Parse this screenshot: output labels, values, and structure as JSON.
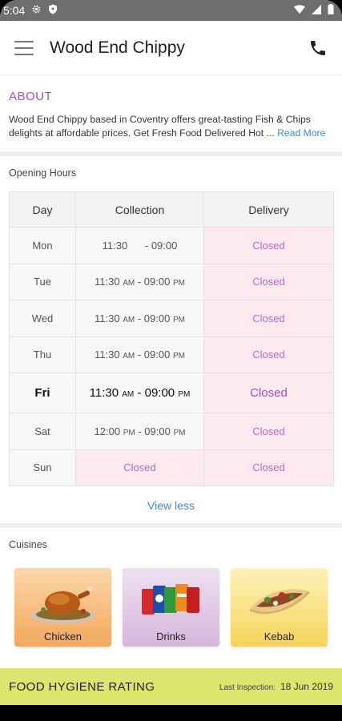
{
  "status": {
    "time": "5:04"
  },
  "appbar": {
    "title": "Wood End Chippy"
  },
  "about": {
    "heading": "ABOUT",
    "text": "Wood End Chippy based in Coventry offers great-tasting Fish & Chips delights at affordable prices. Get Fresh Food Delivered Hot",
    "ellipsis": " ... ",
    "read_more": "Read More"
  },
  "hours": {
    "heading": "Opening Hours",
    "columns": [
      "Day",
      "Collection",
      "Delivery"
    ],
    "rows": [
      {
        "day": "Mon",
        "open": "11:30",
        "open_ampm": "",
        "sep": " - ",
        "close": "09:00",
        "close_ampm": "",
        "delivery": "Closed"
      },
      {
        "day": "Tue",
        "open": "11:30",
        "open_ampm": "AM",
        "sep": " - ",
        "close": "09:00",
        "close_ampm": "PM",
        "delivery": "Closed"
      },
      {
        "day": "Wed",
        "open": "11:30",
        "open_ampm": "AM",
        "sep": " - ",
        "close": "09:00",
        "close_ampm": "PM",
        "delivery": "Closed"
      },
      {
        "day": "Thu",
        "open": "11:30",
        "open_ampm": "AM",
        "sep": " - ",
        "close": "09:00",
        "close_ampm": "PM",
        "delivery": "Closed"
      },
      {
        "day": "Fri",
        "open": "11:30",
        "open_ampm": "AM",
        "sep": " - ",
        "close": "09:00",
        "close_ampm": "PM",
        "delivery": "Closed"
      },
      {
        "day": "Sat",
        "open": "12:00",
        "open_ampm": "PM",
        "sep": " - ",
        "close": "09:00",
        "close_ampm": "PM",
        "delivery": "Closed"
      },
      {
        "day": "Sun",
        "collection": "Closed",
        "delivery": "Closed"
      }
    ],
    "view_less": "View less"
  },
  "cuisines": {
    "heading": "Cuisines",
    "items": [
      {
        "label": "Chicken",
        "icon": "roast-chicken-icon"
      },
      {
        "label": "Drinks",
        "icon": "soda-cans-icon"
      },
      {
        "label": "Kebab",
        "icon": "kebab-wrap-icon"
      }
    ]
  },
  "hygiene": {
    "title": "FOOD HYGIENE RATING",
    "last_inspection_label": "Last Inspection:",
    "last_inspection_date": "18 Jun 2019"
  },
  "colors": {
    "accent_purple": "#a24fc6",
    "link_blue": "#3d8dcc",
    "closed_bg": "#fdeaee",
    "hygiene_bg": "#dde56c"
  }
}
